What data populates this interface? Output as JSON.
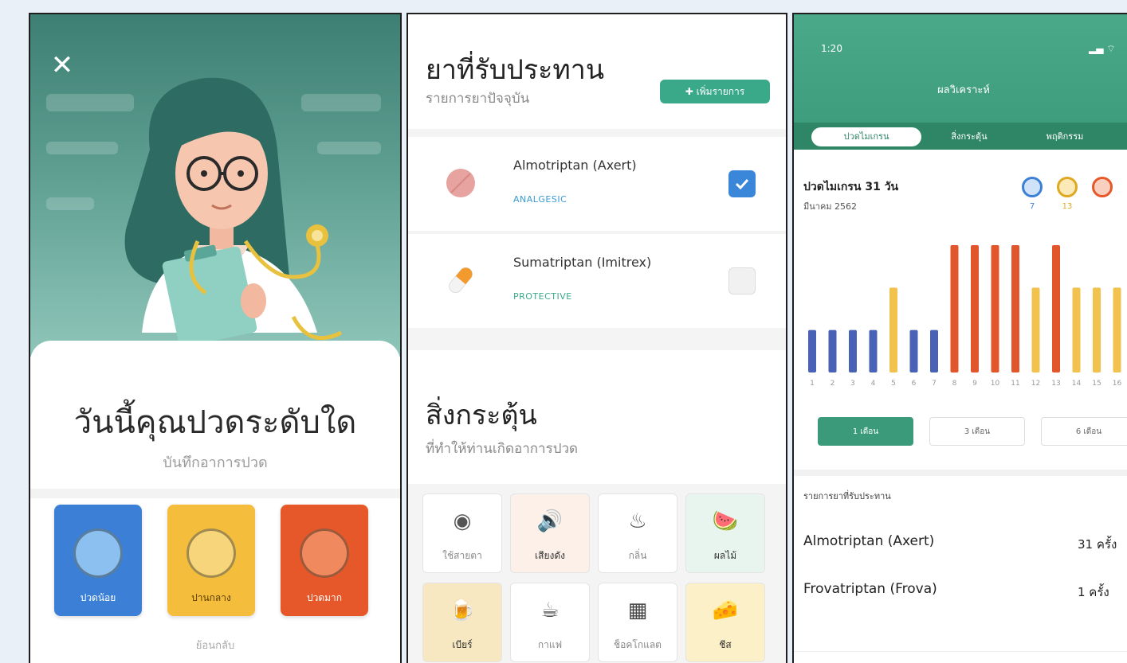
{
  "panel1": {
    "title": "วันนี้คุณปวดระดับใด",
    "subtitle": "บันทึกอาการปวด",
    "moods": [
      {
        "label": "ปวดน้อย",
        "color": "#3b7fd6",
        "face": "#8cc0f0"
      },
      {
        "label": "ปานกลาง",
        "color": "#f4be3c",
        "face": "#f7d57a"
      },
      {
        "label": "ปวดมาก",
        "color": "#e6582a",
        "face": "#f08a5e"
      }
    ],
    "bottom_link": "ย้อนกลับ"
  },
  "panel2": {
    "title": "ยาที่รับประทาน",
    "subtitle": "รายการยาปัจจุบัน",
    "add_button": "เพิ่มรายการ",
    "medications": [
      {
        "name": "Almotriptan (Axert)",
        "category": "ANALGESIC",
        "category_color": "#3a9ad6",
        "checked": true,
        "icon": "round-pill-icon"
      },
      {
        "name": "Sumatriptan (Imitrex)",
        "category": "PROTECTIVE",
        "category_color": "#3aa98a",
        "checked": false,
        "icon": "capsule-icon"
      }
    ],
    "triggers_title": "สิ่งกระตุ้น",
    "triggers_subtitle": "ที่ทำให้ท่านเกิดอาการปวด",
    "triggers": [
      {
        "label": "ใช้สายตา",
        "icon": "eye-icon",
        "glyph": "◉",
        "bg": "#ffffff",
        "active": false
      },
      {
        "label": "เสียงดัง",
        "icon": "speaker-icon",
        "glyph": "🔊",
        "bg": "#fdf0e8",
        "active": true
      },
      {
        "label": "กลิ่น",
        "icon": "smell-icon",
        "glyph": "♨",
        "bg": "#ffffff",
        "active": false
      },
      {
        "label": "ผลไม้",
        "icon": "watermelon-icon",
        "glyph": "🍉",
        "bg": "#e8f5ee",
        "active": true
      },
      {
        "label": "เบียร์",
        "icon": "beer-icon",
        "glyph": "🍺",
        "bg": "#f7e8c2",
        "active": true
      },
      {
        "label": "กาแฟ",
        "icon": "coffee-icon",
        "glyph": "☕",
        "bg": "#ffffff",
        "active": false
      },
      {
        "label": "ช็อคโกแลต",
        "icon": "chocolate-icon",
        "glyph": "▦",
        "bg": "#ffffff",
        "active": false
      },
      {
        "label": "ชีส",
        "icon": "cheese-icon",
        "glyph": "🧀",
        "bg": "#fbf0c8",
        "active": true
      }
    ]
  },
  "panel3": {
    "time": "1:20",
    "status": "▂▄ ⌔",
    "title": "ผลวิเคราะห์",
    "tabs": [
      "ปวดไมเกรน",
      "สิ่งกระตุ้น",
      "พฤติกรรม"
    ],
    "heading": "ปวดไมเกรน 31 วัน",
    "subheading": "มีนาคม 2562",
    "counts": [
      {
        "value": "7",
        "color": "#3b7fd6"
      },
      {
        "value": "13",
        "color": "#e0a820"
      },
      {
        "value": "",
        "color": "#e6582a"
      }
    ],
    "ranges": [
      "1 เดือน",
      "3 เดือน",
      "6 เดือน"
    ],
    "list_title": "รายการยาที่รับประทาน",
    "medications": [
      {
        "name": "Almotriptan (Axert)",
        "value": "31 ครั้ง"
      },
      {
        "name": "Frovatriptan (Frova)",
        "value": "1 ครั้ง"
      }
    ]
  },
  "chart_data": {
    "type": "bar",
    "categories": [
      "1",
      "2",
      "3",
      "4",
      "5",
      "6",
      "7",
      "8",
      "9",
      "10",
      "11",
      "12",
      "13",
      "14",
      "15",
      "16"
    ],
    "values": [
      1,
      1,
      1,
      1,
      2,
      1,
      1,
      3,
      3,
      3,
      3,
      2,
      3,
      2,
      2,
      2
    ],
    "colors_by_level": {
      "1": "#4a62b5",
      "2": "#f2c24e",
      "3": "#e2562b"
    },
    "ylim": [
      0,
      3
    ]
  }
}
